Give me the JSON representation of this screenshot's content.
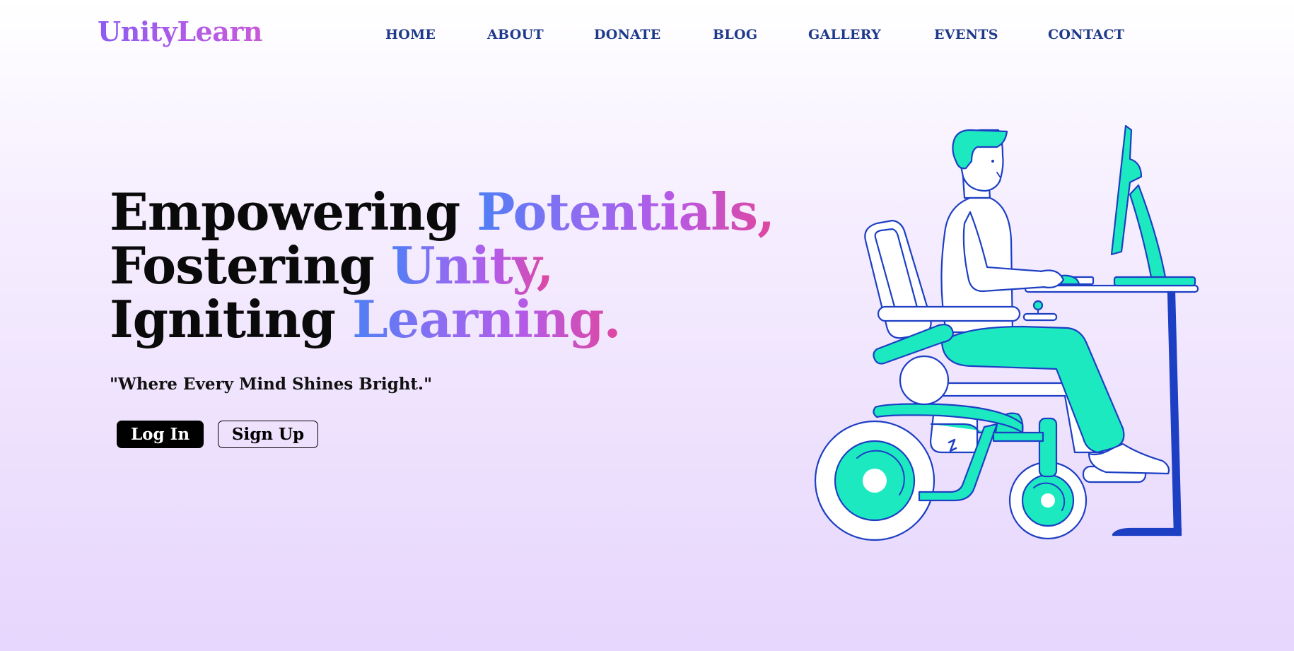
{
  "brand": {
    "logo_text": "UnityLearn"
  },
  "nav": {
    "items": [
      {
        "label": "HOME"
      },
      {
        "label": "ABOUT"
      },
      {
        "label": "DONATE"
      },
      {
        "label": "BLOG"
      },
      {
        "label": "GALLERY"
      },
      {
        "label": "EVENTS"
      },
      {
        "label": "CONTACT"
      }
    ]
  },
  "hero": {
    "line1_plain": "Empowering ",
    "line1_accent": "Potentials,",
    "line2_plain": "Fostering ",
    "line2_accent": "Unity,",
    "line3_plain": "Igniting ",
    "line3_accent": "Learning.",
    "tagline": "\"Where Every Mind Shines Bright.\"",
    "login_label": "Log In",
    "signup_label": "Sign Up"
  },
  "colors": {
    "nav_text": "#1e3a8a",
    "accent_teal": "#1de9c1",
    "outline_blue": "#1d3fc4",
    "gradient_start": "#4f7ff5",
    "gradient_end": "#e0479c"
  },
  "illustration": {
    "icon": "wheelchair-user-at-computer-illustration"
  }
}
